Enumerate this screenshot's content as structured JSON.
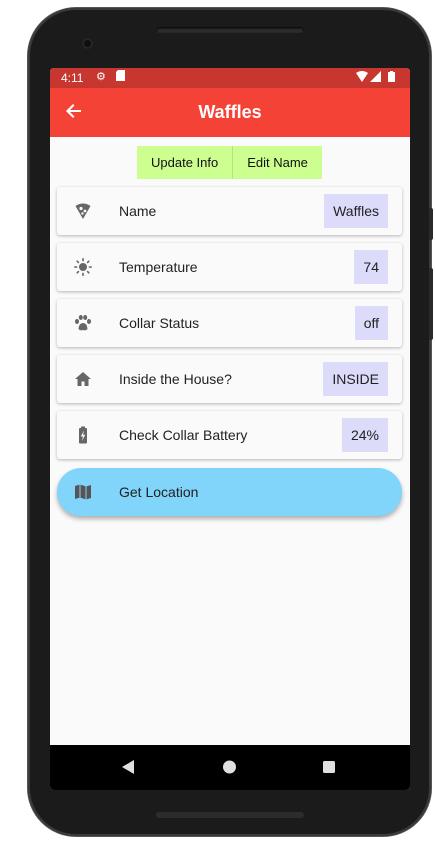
{
  "status_bar": {
    "time": "4:11"
  },
  "app_bar": {
    "title": "Waffles"
  },
  "actions": {
    "update_label": "Update Info",
    "edit_label": "Edit Name"
  },
  "rows": [
    {
      "icon": "pizza-icon",
      "label": "Name",
      "value": "Waffles"
    },
    {
      "icon": "sun-icon",
      "label": "Temperature",
      "value": "74"
    },
    {
      "icon": "paw-icon",
      "label": "Collar Status",
      "value": "off"
    },
    {
      "icon": "home-icon",
      "label": "Inside the House?",
      "value": "INSIDE"
    },
    {
      "icon": "battery-charging-icon",
      "label": "Check Collar Battery",
      "value": "24%"
    }
  ],
  "location_button": {
    "icon": "map-icon",
    "label": "Get Location"
  },
  "colors": {
    "app_bar": "#f44336",
    "status_bar": "#c7372f",
    "action_buttons": "#ccff90",
    "value_chip": "#dcdcfa",
    "location_button": "#81d4fa"
  }
}
